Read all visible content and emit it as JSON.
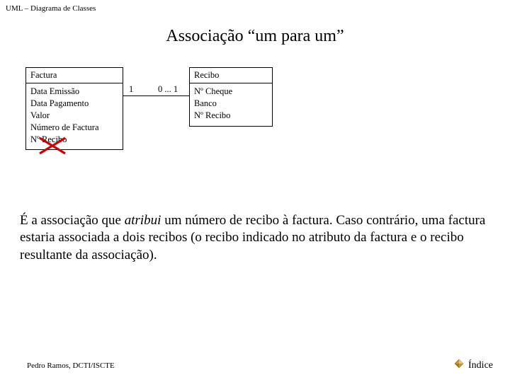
{
  "header": "UML – Diagrama de Classes",
  "title": "Associação “um para um”",
  "diagram": {
    "left_class": {
      "name": "Factura",
      "attrs": [
        "Data Emissão",
        "Data Pagamento",
        "Valor",
        "Número de Factura",
        "Nº Recibo"
      ]
    },
    "right_class": {
      "name": "Recibo",
      "attrs": [
        "Nº Cheque",
        "Banco",
        "Nº Recibo"
      ]
    },
    "mult_left": "1",
    "mult_right": "0 ... 1"
  },
  "paragraph": {
    "p1a": "É a associação que ",
    "p1_em": "atribui",
    "p1b": " um número de recibo à factura. Caso contrário, uma factura estaria associada a dois recibos (o recibo indicado no atributo da factura e o recibo resultante da associação)."
  },
  "footer": {
    "left": "Pedro Ramos, DCTI/ISCTE",
    "right": "Índice"
  }
}
